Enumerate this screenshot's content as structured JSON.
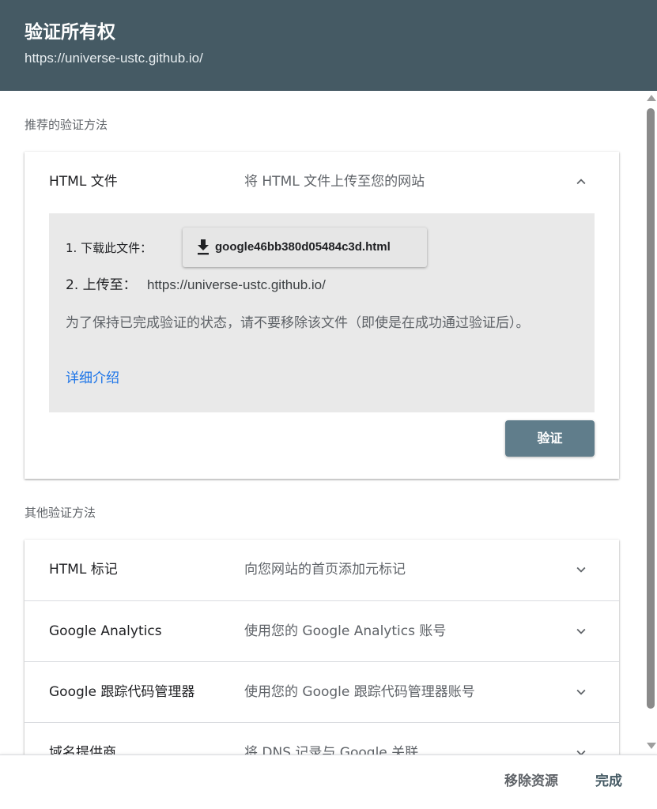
{
  "header": {
    "title": "验证所有权",
    "url": "https://universe-ustc.github.io/"
  },
  "recommended": {
    "section_label": "推荐的验证方法",
    "method": {
      "name": "HTML 文件",
      "description": "将 HTML 文件上传至您的网站",
      "expanded": true,
      "step1_label": "1. 下载此文件：",
      "download_filename": "google46bb380d05484c3d.html",
      "step2_label": "2. 上传至：",
      "upload_url": "https://universe-ustc.github.io/",
      "note": "为了保持已完成验证的状态，请不要移除该文件（即使是在成功通过验证后）。",
      "learn_more": "详细介绍",
      "verify_label": "验证"
    }
  },
  "other": {
    "section_label": "其他验证方法",
    "methods": [
      {
        "name": "HTML 标记",
        "description": "向您网站的首页添加元标记"
      },
      {
        "name": "Google Analytics",
        "description": "使用您的 Google Analytics 账号"
      },
      {
        "name": "Google 跟踪代码管理器",
        "description": "使用您的 Google 跟踪代码管理器账号"
      },
      {
        "name": "域名提供商",
        "description": "将 DNS 记录与 Google 关联"
      }
    ]
  },
  "footer": {
    "remove_label": "移除资源",
    "done_label": "完成"
  },
  "colors": {
    "header_bg": "#455a64",
    "verify_bg": "#607d8b",
    "link": "#1a73e8",
    "panel_bg": "#e9e9e9"
  },
  "icons": {
    "expanded_chevron": "chevron-up-icon",
    "collapsed_chevron": "chevron-down-icon",
    "download": "download-icon"
  }
}
